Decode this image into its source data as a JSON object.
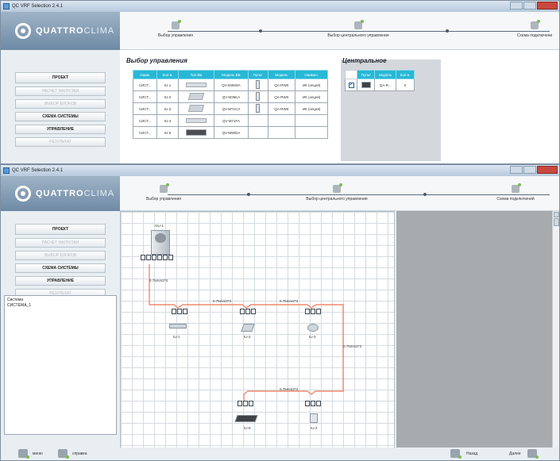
{
  "app": {
    "title": "QC VRF Selection 2.4.1",
    "brand_main": "QUATTRO",
    "brand_sub": "CLIMA"
  },
  "steps": [
    {
      "label": "Выбор управления"
    },
    {
      "label": "Выбор центрального управления"
    },
    {
      "label": "Схема подключений"
    }
  ],
  "win1_steps": [
    {
      "label": "Выбор управления"
    },
    {
      "label": "Выбор центрального управления"
    },
    {
      "label": "Схема подключени"
    }
  ],
  "menu": {
    "project": "ПРОЕКТ",
    "load_calc": "РАСЧЕТ НАГРУЗКИ",
    "unit_select": "ВЫБОР БЛОКОВ",
    "system_scheme": "СХЕМА СИСТЕМЫ",
    "control": "УПРАВЛЕНИЕ",
    "result": "РЕЗУЛЬТАТ"
  },
  "control_selection": {
    "title": "Выбор управления",
    "headers": [
      "Наим.",
      "Кол-в.",
      "Тип ВБ",
      "Модель ВБ",
      "Пульт",
      "Модель",
      "Наимен."
    ],
    "rows": [
      {
        "name": "СИСТ...",
        "id": "IU-1",
        "model": "QV-M36WA",
        "remote_model": "QA-RWK",
        "remote_desc": "ИК (опция)"
      },
      {
        "name": "СИСТ...",
        "id": "IU-2",
        "model": "QV-M36KA",
        "remote_model": "QA-RWK",
        "remote_desc": "ИК (опция)"
      },
      {
        "name": "СИСТ...",
        "id": "IU-3",
        "model": "QV-M71CA",
        "remote_model": "QA-RWK",
        "remote_desc": "ИК (опция)"
      },
      {
        "name": "СИСТ...",
        "id": "IU-4",
        "model": "QV-M71FA",
        "remote_model": "",
        "remote_desc": ""
      },
      {
        "name": "СИСТ...",
        "id": "IU-5",
        "model": "QV-M90DA",
        "remote_model": "",
        "remote_desc": ""
      }
    ]
  },
  "central": {
    "title": "Центральное",
    "headers": [
      "Пульт",
      "Модель",
      "Кол-в."
    ],
    "row": {
      "model": "QA-R...",
      "qty": "0"
    }
  },
  "tree": {
    "root": "Система",
    "child": "СИСТЕМА_1"
  },
  "diagram": {
    "outdoor_label": "OU-1",
    "wire_labels": [
      "0.75mm2*3",
      "0.75mm2*3",
      "0.75mm2*3",
      "0.75mm2*3",
      "0.75mm2*3"
    ],
    "units": [
      {
        "label": "IU-1"
      },
      {
        "label": "IU-2"
      },
      {
        "label": "IU-3"
      },
      {
        "label": "IU-5"
      },
      {
        "label": "IU-4"
      }
    ],
    "wire_color": "#f08a6e"
  },
  "bottom": {
    "menu": "меню",
    "help": "справка",
    "back": "Назад",
    "next": "Далее"
  }
}
